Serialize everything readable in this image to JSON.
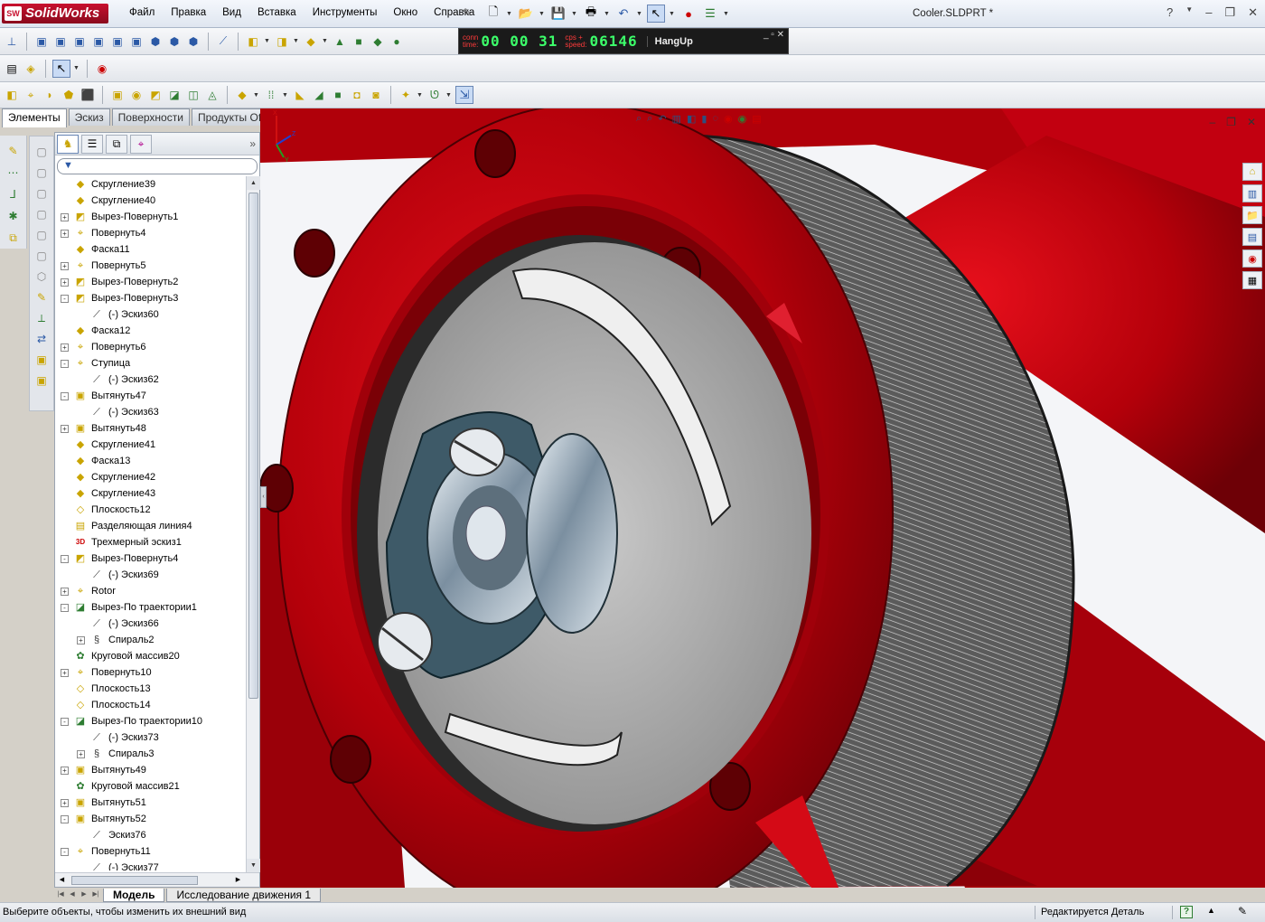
{
  "app": {
    "logo_text": "SolidWorks",
    "logo_badge": "SW",
    "menus": [
      "Файл",
      "Правка",
      "Вид",
      "Вставка",
      "Инструменты",
      "Окно",
      "Справка"
    ],
    "document_title": "Cooler.SLDPRT *"
  },
  "macro_recorder": {
    "conn_label": "conn",
    "time_label": "time:",
    "time_value": "00 00 31",
    "cps_label": "cps +",
    "speed_label": "speed:",
    "speed_value": "06146",
    "status": "HangUp"
  },
  "command_tabs": [
    "Элементы",
    "Эскиз",
    "Поверхности",
    "Продукты Office"
  ],
  "feature_tree": [
    {
      "label": "Скругление39",
      "level": 0,
      "expander": "",
      "icon": "fillet-icon"
    },
    {
      "label": "Скругление40",
      "level": 0,
      "expander": "",
      "icon": "fillet-icon"
    },
    {
      "label": "Вырез-Повернуть1",
      "level": 0,
      "expander": "+",
      "icon": "revolve-cut-icon"
    },
    {
      "label": "Повернуть4",
      "level": 0,
      "expander": "+",
      "icon": "revolve-icon"
    },
    {
      "label": "Фаска11",
      "level": 0,
      "expander": "",
      "icon": "chamfer-icon"
    },
    {
      "label": "Повернуть5",
      "level": 0,
      "expander": "+",
      "icon": "revolve-icon"
    },
    {
      "label": "Вырез-Повернуть2",
      "level": 0,
      "expander": "+",
      "icon": "revolve-cut-icon"
    },
    {
      "label": "Вырез-Повернуть3",
      "level": 0,
      "expander": "-",
      "icon": "revolve-cut-icon"
    },
    {
      "label": "(-) Эскиз60",
      "level": 1,
      "expander": "",
      "icon": "sketch-icon"
    },
    {
      "label": "Фаска12",
      "level": 0,
      "expander": "",
      "icon": "chamfer-icon"
    },
    {
      "label": "Повернуть6",
      "level": 0,
      "expander": "+",
      "icon": "revolve-icon"
    },
    {
      "label": "Ступица",
      "level": 0,
      "expander": "-",
      "icon": "revolve-icon"
    },
    {
      "label": "(-) Эскиз62",
      "level": 1,
      "expander": "",
      "icon": "sketch-icon"
    },
    {
      "label": "Вытянуть47",
      "level": 0,
      "expander": "-",
      "icon": "extrude-icon"
    },
    {
      "label": "(-) Эскиз63",
      "level": 1,
      "expander": "",
      "icon": "sketch-icon"
    },
    {
      "label": "Вытянуть48",
      "level": 0,
      "expander": "+",
      "icon": "extrude-icon"
    },
    {
      "label": "Скругление41",
      "level": 0,
      "expander": "",
      "icon": "fillet-icon"
    },
    {
      "label": "Фаска13",
      "level": 0,
      "expander": "",
      "icon": "chamfer-icon"
    },
    {
      "label": "Скругление42",
      "level": 0,
      "expander": "",
      "icon": "fillet-icon"
    },
    {
      "label": "Скругление43",
      "level": 0,
      "expander": "",
      "icon": "fillet-icon"
    },
    {
      "label": "Плоскость12",
      "level": 0,
      "expander": "",
      "icon": "plane-icon"
    },
    {
      "label": "Разделяющая линия4",
      "level": 0,
      "expander": "",
      "icon": "split-line-icon"
    },
    {
      "label": "Трехмерный эскиз1",
      "level": 0,
      "expander": "",
      "icon": "3d-sketch-icon"
    },
    {
      "label": "Вырез-Повернуть4",
      "level": 0,
      "expander": "-",
      "icon": "revolve-cut-icon"
    },
    {
      "label": "(-) Эскиз69",
      "level": 1,
      "expander": "",
      "icon": "sketch-icon"
    },
    {
      "label": "Rotor",
      "level": 0,
      "expander": "+",
      "icon": "revolve-icon"
    },
    {
      "label": "Вырез-По траектории1",
      "level": 0,
      "expander": "-",
      "icon": "sweep-cut-icon"
    },
    {
      "label": "(-) Эскиз66",
      "level": 1,
      "expander": "",
      "icon": "sketch-icon"
    },
    {
      "label": "Спираль2",
      "level": 1,
      "expander": "+",
      "icon": "helix-icon"
    },
    {
      "label": "Круговой массив20",
      "level": 0,
      "expander": "",
      "icon": "circular-pattern-icon"
    },
    {
      "label": "Повернуть10",
      "level": 0,
      "expander": "+",
      "icon": "revolve-icon"
    },
    {
      "label": "Плоскость13",
      "level": 0,
      "expander": "",
      "icon": "plane-icon"
    },
    {
      "label": "Плоскость14",
      "level": 0,
      "expander": "",
      "icon": "plane-icon"
    },
    {
      "label": "Вырез-По траектории10",
      "level": 0,
      "expander": "-",
      "icon": "sweep-cut-icon"
    },
    {
      "label": "(-) Эскиз73",
      "level": 1,
      "expander": "",
      "icon": "sketch-icon"
    },
    {
      "label": "Спираль3",
      "level": 1,
      "expander": "+",
      "icon": "helix-icon"
    },
    {
      "label": "Вытянуть49",
      "level": 0,
      "expander": "+",
      "icon": "extrude-icon"
    },
    {
      "label": "Круговой массив21",
      "level": 0,
      "expander": "",
      "icon": "circular-pattern-icon"
    },
    {
      "label": "Вытянуть51",
      "level": 0,
      "expander": "+",
      "icon": "extrude-icon"
    },
    {
      "label": "Вытянуть52",
      "level": 0,
      "expander": "-",
      "icon": "extrude-icon"
    },
    {
      "label": "Эскиз76",
      "level": 1,
      "expander": "",
      "icon": "sketch-icon"
    },
    {
      "label": "Повернуть11",
      "level": 0,
      "expander": "-",
      "icon": "revolve-icon"
    },
    {
      "label": "(-) Эскиз77",
      "level": 1,
      "expander": "",
      "icon": "sketch-icon"
    }
  ],
  "model_tabs": [
    "Модель",
    "Исследование движения 1"
  ],
  "status": {
    "hint": "Выберите объекты, чтобы изменить их внешний вид",
    "mode": "Редактируется Деталь",
    "help": "?"
  },
  "triad": {
    "x": "X",
    "y": "Y",
    "z": "Z"
  },
  "colors": {
    "part_red": "#c4000b",
    "steel": "#9aa0a6",
    "accent": "#2b59a6"
  }
}
